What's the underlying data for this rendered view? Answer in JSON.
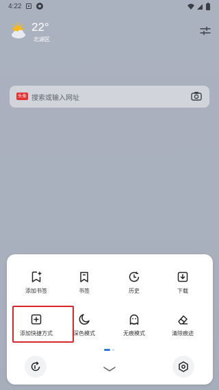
{
  "status_bar": {
    "time": "4:22"
  },
  "weather": {
    "temperature": "22°",
    "location": "北湖区",
    "icon": "sun-cloud-icon"
  },
  "search": {
    "badge": "头条",
    "placeholder": "搜索或输入网址"
  },
  "menu": {
    "items": [
      {
        "label": "添加书签",
        "icon": "add-bookmark-icon"
      },
      {
        "label": "书签",
        "icon": "bookmark-icon"
      },
      {
        "label": "历史",
        "icon": "history-icon"
      },
      {
        "label": "下载",
        "icon": "download-icon"
      },
      {
        "label": "添加快捷方式",
        "icon": "add-shortcut-icon"
      },
      {
        "label": "深色模式",
        "icon": "moon-icon"
      },
      {
        "label": "无痕模式",
        "icon": "ghost-icon"
      },
      {
        "label": "清除痕迹",
        "icon": "eraser-icon"
      }
    ],
    "page_indicator": {
      "current_page": 1,
      "page_count": 2
    },
    "bottom_icons": [
      "refresh-icon",
      "chevron-down-icon",
      "settings-hexagon-icon"
    ]
  },
  "colors": {
    "accent": "#2a79d8",
    "highlight": "#d9262c",
    "badge": "#e8302f"
  }
}
